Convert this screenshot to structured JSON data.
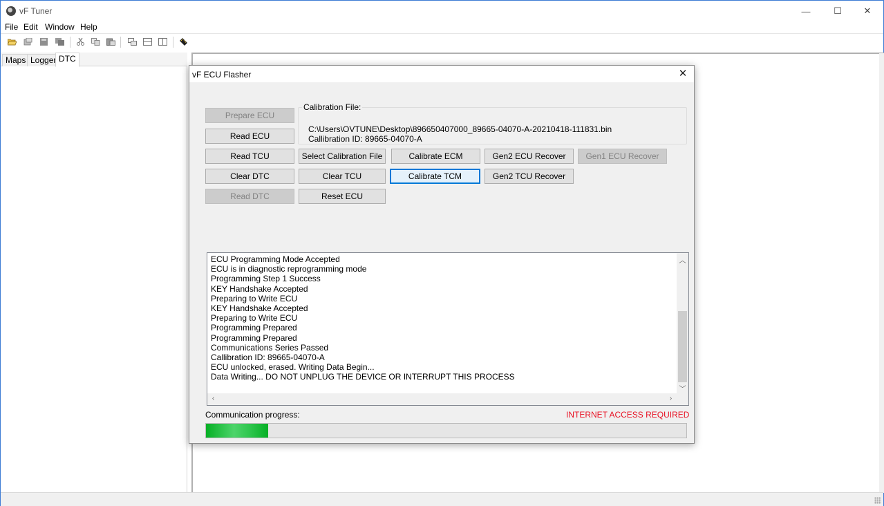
{
  "window": {
    "title": "vF Tuner",
    "minimize_glyph": "—",
    "maximize_glyph": "☐",
    "close_glyph": "✕"
  },
  "menu": [
    "File",
    "Edit",
    "Window",
    "Help"
  ],
  "toolbar_icons": [
    "open-folder-icon",
    "open-file-icon",
    "save-icon",
    "save-all-icon",
    "cut-icon",
    "copy-icon",
    "paste-icon",
    "cascade-windows-icon",
    "tile-horizontal-icon",
    "tile-vertical-icon",
    "ruler-icon"
  ],
  "left_tabs": [
    {
      "label": "Maps",
      "active": false
    },
    {
      "label": "Logger",
      "active": false
    },
    {
      "label": "DTC",
      "active": true
    }
  ],
  "dialog": {
    "title": "vF ECU Flasher",
    "close_glyph": "✕",
    "calibration_file_label": "Calibration File:",
    "calibration_path": "C:\\Users\\OVTUNE\\Desktop\\896650407000_89665-04070-A-20210418-111831.bin",
    "calibration_id": "Callibration ID: 89665-04070-A",
    "buttons": {
      "prepare_ecu": "Prepare ECU",
      "read_ecu": "Read ECU",
      "read_tcu": "Read TCU",
      "select_calibration_file": "Select Calibration File",
      "calibrate_ecm": "Calibrate ECM",
      "gen2_ecu_recover": "Gen2 ECU Recover",
      "gen1_ecu_recover": "Gen1 ECU Recover",
      "clear_dtc": "Clear DTC",
      "clear_tcu": "Clear TCU",
      "calibrate_tcm": "Calibrate TCM",
      "gen2_tcu_recover": "Gen2 TCU Recover",
      "read_dtc": "Read DTC",
      "reset_ecu": "Reset ECU"
    },
    "log_lines": [
      "ECU Programming Mode Accepted",
      "ECU is in diagnostic reprogramming mode",
      "Programming Step 1 Success",
      "KEY Handshake Accepted",
      "Preparing to Write ECU",
      "KEY Handshake Accepted",
      "Preparing to Write ECU",
      "Programming Prepared",
      "Programming Prepared",
      "Communications Series Passed",
      "Callibration ID: 89665-04070-A",
      "ECU unlocked, erased. Writing Data Begin...",
      "Data Writing... DO NOT UNPLUG THE DEVICE OR INTERRUPT THIS PROCESS"
    ],
    "progress_label": "Communication progress:",
    "internet_notice": "INTERNET ACCESS REQUIRED",
    "internet_notice_color": "#e81123",
    "progress_fraction": 0.13
  }
}
